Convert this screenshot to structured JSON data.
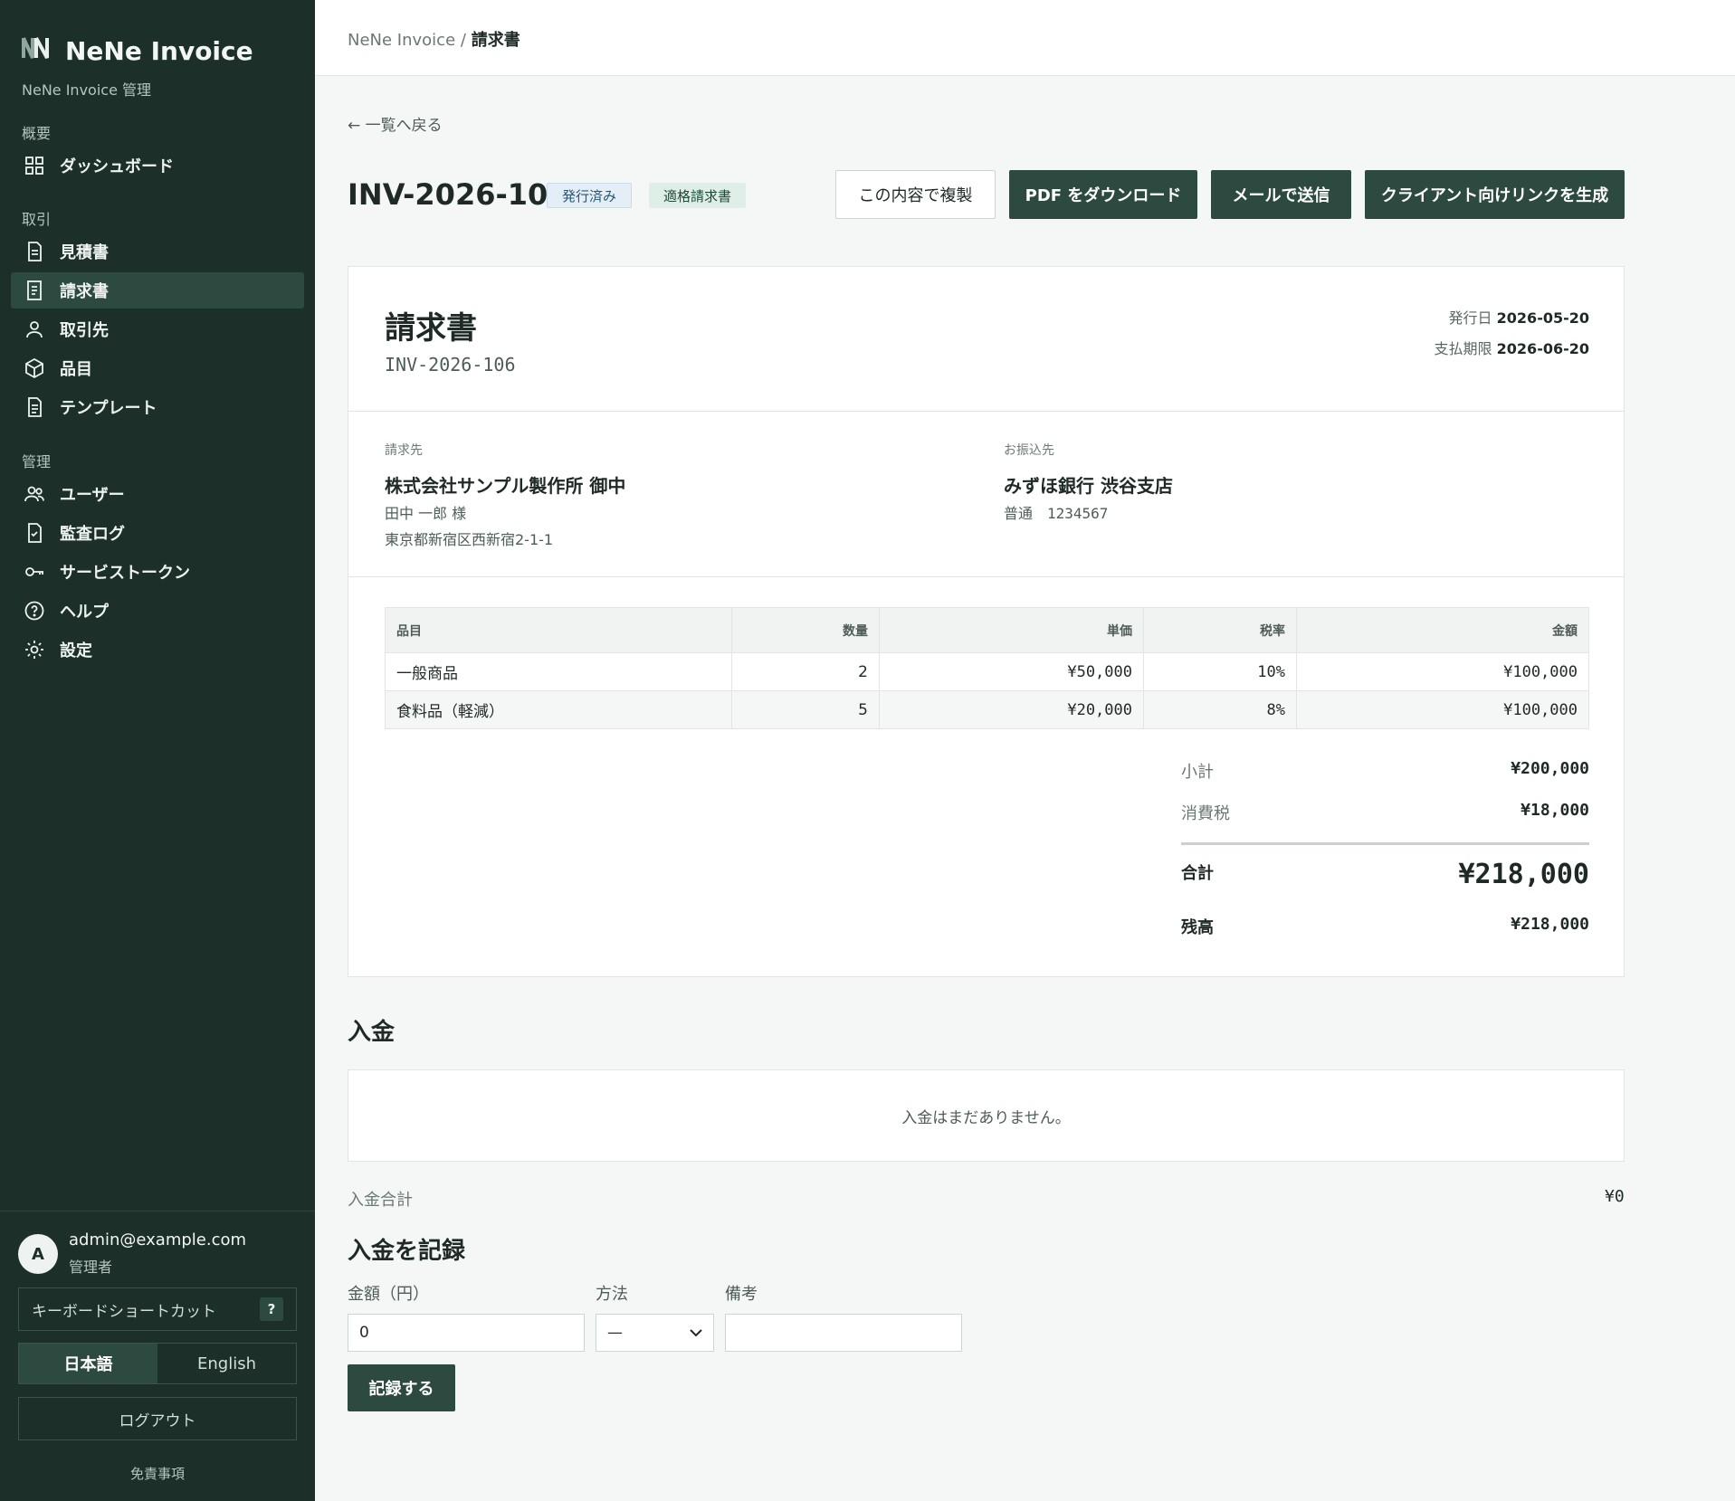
{
  "app": {
    "logo": "N",
    "name": "NeNe Invoice",
    "subtitle": "NeNe Invoice 管理"
  },
  "sidebar": {
    "sections": {
      "overview": "概要",
      "transactions": "取引",
      "admin": "管理"
    },
    "items": [
      {
        "label": "ダッシュボード",
        "icon": "dashboard-icon"
      },
      {
        "label": "見積書",
        "icon": "document-icon"
      },
      {
        "label": "請求書",
        "icon": "invoice-icon"
      },
      {
        "label": "取引先",
        "icon": "person-icon"
      },
      {
        "label": "品目",
        "icon": "box-icon"
      },
      {
        "label": "テンプレート",
        "icon": "template-icon"
      },
      {
        "label": "ユーザー",
        "icon": "users-icon"
      },
      {
        "label": "監査ログ",
        "icon": "audit-log-icon"
      },
      {
        "label": "サービストークン",
        "icon": "key-icon"
      },
      {
        "label": "ヘルプ",
        "icon": "help-icon"
      },
      {
        "label": "設定",
        "icon": "settings-icon"
      }
    ],
    "active_index": 2,
    "user": {
      "initial": "A",
      "email": "admin@example.com",
      "role": "管理者"
    },
    "shortcut_label": "キーボードショートカット",
    "shortcut_key": "?",
    "lang": {
      "ja": "日本語",
      "en": "English",
      "selected": "ja"
    },
    "logout": "ログアウト",
    "disclaimer": "免責事項"
  },
  "breadcrumb": {
    "root": "NeNe Invoice",
    "sep": "/",
    "current": "請求書"
  },
  "back_link": "← 一覧へ戻る",
  "invoice": {
    "number": "INV-2026-106",
    "badges": {
      "status": "発行済み",
      "qualified": "適格請求書"
    },
    "actions": {
      "duplicate": "この内容で複製",
      "pdf": "PDF をダウンロード",
      "email": "メールで送信",
      "client_link": "クライアント向けリンクを生成"
    },
    "doc_title": "請求書",
    "issue_date_label": "発行日",
    "issue_date": "2026-05-20",
    "due_date_label": "支払期限",
    "due_date": "2026-06-20",
    "bill_to": {
      "label": "請求先",
      "name": "株式会社サンプル製作所 御中",
      "contact": "田中 一郎 様",
      "address": "東京都新宿区西新宿2-1-1"
    },
    "bank": {
      "label": "お振込先",
      "name": "みずほ銀行 渋谷支店",
      "account": "普通　1234567"
    },
    "table": {
      "headers": {
        "item": "品目",
        "qty": "数量",
        "unit": "単価",
        "tax": "税率",
        "amount": "金額"
      },
      "rows": [
        {
          "item": "一般商品",
          "qty": "2",
          "unit": "¥50,000",
          "tax": "10%",
          "amount": "¥100,000"
        },
        {
          "item": "食料品（軽減）",
          "qty": "5",
          "unit": "¥20,000",
          "tax": "8%",
          "amount": "¥100,000"
        }
      ]
    },
    "totals": {
      "subtotal_label": "小計",
      "subtotal": "¥200,000",
      "tax_label": "消費税",
      "tax": "¥18,000",
      "total_label": "合計",
      "total": "¥218,000",
      "balance_label": "残高",
      "balance": "¥218,000"
    }
  },
  "payments": {
    "heading": "入金",
    "empty": "入金はまだありません。",
    "total_label": "入金合計",
    "total": "¥0",
    "record_heading": "入金を記録",
    "form": {
      "amount_label": "金額（円）",
      "amount_value": "0",
      "method_label": "方法",
      "method_value": "—",
      "note_label": "備考",
      "note_value": "",
      "submit": "記録する"
    }
  }
}
